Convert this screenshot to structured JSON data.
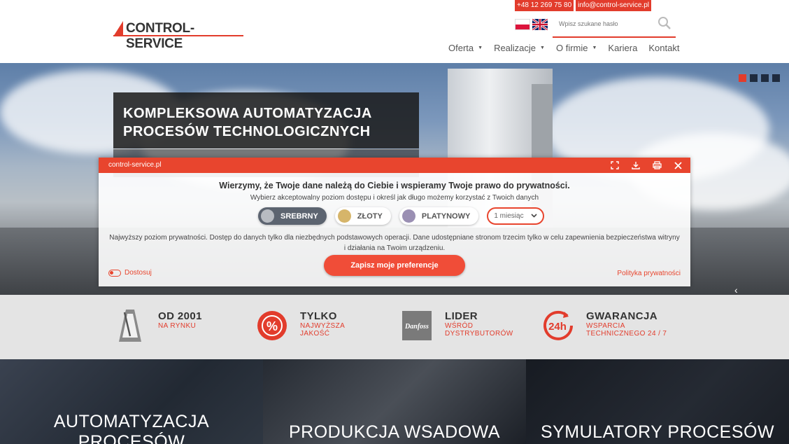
{
  "header": {
    "logo_text": "CONTROL-SERVICE",
    "phone": "+48 12 269 75 80",
    "email": "info@control-service.pl",
    "search_placeholder": "Wpisz szukane hasło",
    "nav": [
      {
        "label": "Oferta",
        "dropdown": true
      },
      {
        "label": "Realizacje",
        "dropdown": true
      },
      {
        "label": "O firmie",
        "dropdown": true
      },
      {
        "label": "Kariera",
        "dropdown": false
      },
      {
        "label": "Kontakt",
        "dropdown": false
      }
    ],
    "languages": [
      "pl-flag-icon",
      "uk-flag-icon"
    ]
  },
  "hero": {
    "title_line1": "KOMPLEKSOWA AUTOMATYZACJA",
    "title_line2": "PROCESÓW TECHNOLOGICZNYCH",
    "slides": 4,
    "active_slide": 1
  },
  "privacy": {
    "site": "control-service.pl",
    "title": "Wierzymy, że Twoje dane należą do Ciebie i wspieramy Twoje prawo do prywatności.",
    "subtitle": "Wybierz akceptowalny poziom dostępu i określ jak długo możemy korzystać z Twoich danych",
    "plans": [
      {
        "label": "SREBRNY",
        "color": "#b8bcc2",
        "active": true
      },
      {
        "label": "ZŁOTY",
        "color": "#d6b56a",
        "active": false
      },
      {
        "label": "PLATYNOWY",
        "color": "#9a8fb3",
        "active": false
      }
    ],
    "duration": "1 miesiąc",
    "description_line1": "Najwyższy poziom prywatności. Dostęp do danych tylko dla niezbędnych podstawowych operacji. Dane udostępniane stronom trzecim tylko w celu zapewnienia bezpieczeństwa witryny",
    "description_line2": "i działania na Twoim urządzeniu.",
    "save_label": "Zapisz moje preferencje",
    "adjust_label": "Dostosuj",
    "policy_label": "Polityka prywatności"
  },
  "features": [
    {
      "title": "OD 2001",
      "sub1": "NA RYNKU",
      "sub2": "",
      "icon": "metronome-icon"
    },
    {
      "title": "TYLKO",
      "sub1": "NAJWYŻSZA",
      "sub2": "JAKOŚĆ",
      "icon": "percent-badge-icon"
    },
    {
      "title": "LIDER",
      "sub1": "WŚRÓD",
      "sub2": "DYSTRYBUTORÓW",
      "icon": "danfoss-logo-icon"
    },
    {
      "title": "GWARANCJA",
      "sub1": "WSPARCIA",
      "sub2": "TECHNICZNEGO 24 / 7",
      "icon": "24h-icon"
    }
  ],
  "tiles": [
    {
      "label": "AUTOMATYZACJA",
      "label2": "PROCESÓW"
    },
    {
      "label": "PRODUKCJA WSADOWA"
    },
    {
      "label": "SYMULATORY PROCESÓW"
    }
  ],
  "colors": {
    "accent": "#e23c2c",
    "modal_accent": "#e8452e"
  }
}
